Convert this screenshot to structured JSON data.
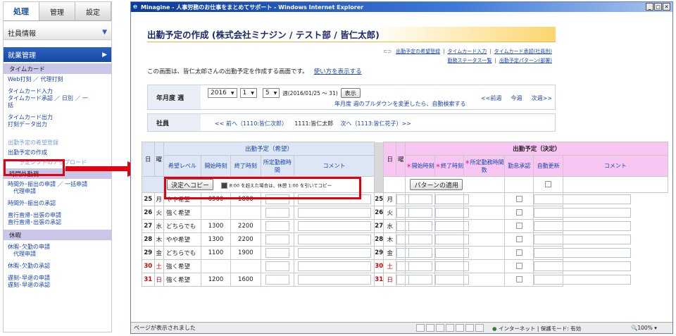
{
  "sidebar": {
    "tabs": [
      "処理",
      "管理",
      "設定"
    ],
    "info": "社員情報",
    "kinmu": "就業管理",
    "sections": {
      "timecard": "タイムカード",
      "overtime": "時間外勤務",
      "leave": "休暇"
    },
    "links": {
      "web": "Web打刻 ／ 代理打刻",
      "tc_input": "タイムカード入力",
      "tc_appr1": "タイムカード承認 ／ 日別 ／ 一",
      "tc_appr2": "括",
      "tc_out": "タイムカード出力",
      "print": "打刻データ出力",
      "hidden": "出勤予定の希望登録",
      "create": "出勤予定の作成",
      "upload": "予定シフトのアップロード",
      "ot_req": "時間外･振出の申請 ／ 一括申請",
      "ot_proxy": "代理申請",
      "ot_appr": "時間外･振出の承認",
      "direct_req": "直行直帰･出張の申請",
      "direct_appr": "直行直帰･出張の承認",
      "leave_req": "休暇･欠勤の申請",
      "leave_proxy": "代理申請",
      "leave_appr": "休暇･欠勤の承認",
      "late_req": "遅刻･早退の申請",
      "late_appr": "遅刻･早退の承認"
    }
  },
  "window": {
    "title": "Minagine - 人事労務のお仕事をまとめてサポート - Windows Internet Explorer",
    "page_title": "出勤予定の作成 (株式会社ミナジン / テスト部 / 皆仁太郎)",
    "links_row1": [
      "出勤予定の希望登録",
      "タイムカード入力",
      "タイムカード承認(社員別)"
    ],
    "links_row2": [
      "勤務ステータス一覧",
      "出勤予定パターン(部署)"
    ],
    "note": "この画面は、皆仁太郎さんの出勤予定を作成する画面です。",
    "howto": "使い方を表示する",
    "period_label": "年月度 週",
    "year": "2016",
    "month": "1",
    "week": "5",
    "week_range": "週(2016/01/25 〜 31)",
    "show_btn": "表示",
    "auto_note": "年月度 週のプルダウンを変更したら、自動検索する",
    "nav": [
      "<<前週",
      "今週",
      "次週>>"
    ],
    "emp_label": "社員",
    "prev_emp": "<< 前へ（1110:皆仁次郎）",
    "cur_emp": "1111:皆仁太郎",
    "next_emp": "次へ（1113:皆仁花子）>>",
    "grid": {
      "title_a": "出勤予定（希望）",
      "title_b": "出勤予定（決定）",
      "day": "日",
      "dow": "曜",
      "colsA": [
        "希望レベル",
        "開始時刻",
        "終了時刻",
        "所定勤務時間",
        "コメント"
      ],
      "colsB": [
        "開始時刻",
        "終了時刻",
        "所定勤務時間数",
        "勤怠承認",
        "自動更新",
        "コメント"
      ],
      "req_mark": "＊",
      "copy_btn": "決定へコピー",
      "copy_note": "8:00 を超えた場合は、休憩 1:00 を引いてコピー",
      "pattern_btn": "パターンの適用",
      "rows": [
        {
          "d": "25",
          "w": "月",
          "lvl": "やや希望",
          "s": "0900",
          "e": "1800",
          "red": false
        },
        {
          "d": "26",
          "w": "火",
          "lvl": "強く希望",
          "s": "",
          "e": "",
          "red": false
        },
        {
          "d": "27",
          "w": "水",
          "lvl": "どちらでも",
          "s": "1300",
          "e": "2200",
          "red": false
        },
        {
          "d": "28",
          "w": "木",
          "lvl": "やや希望",
          "s": "1300",
          "e": "2200",
          "red": false
        },
        {
          "d": "29",
          "w": "金",
          "lvl": "どちらでも",
          "s": "1100",
          "e": "1900",
          "red": false
        },
        {
          "d": "30",
          "w": "土",
          "lvl": "強く希望",
          "s": "",
          "e": "",
          "red": true
        },
        {
          "d": "31",
          "w": "日",
          "lvl": "強く希望",
          "s": "1200",
          "e": "1600",
          "red": true
        }
      ]
    },
    "status": "ページが表示されました",
    "zone": "インターネット | 保護モード: 有効",
    "zoom": "100%"
  },
  "colors": {
    "accent": "#e4000f",
    "link": "#1844b0",
    "title": "#1a2a6b"
  }
}
